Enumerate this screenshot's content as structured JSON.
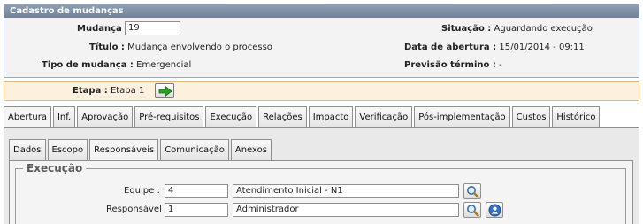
{
  "header": {
    "title": "Cadastro de mudanças",
    "mudanca_label": "Mudança :",
    "mudanca_value": "19",
    "titulo_label": "Título :",
    "titulo_value": "Mudança envolvendo o processo",
    "tipo_label": "Tipo de mudança :",
    "tipo_value": "Emergencial",
    "situacao_label": "Situação :",
    "situacao_value": "Aguardando execução",
    "abertura_label": "Data de abertura :",
    "abertura_value": "15/01/2014 - 09:11",
    "previsao_label": "Previsão término :",
    "previsao_value": "-"
  },
  "stage": {
    "label": "Etapa :",
    "value": "Etapa 1",
    "next_icon": "green-arrow-right-icon"
  },
  "outer_tabs": [
    {
      "label": "Abertura",
      "active": true
    },
    {
      "label": "Inf.",
      "active": false
    },
    {
      "label": "Aprovação",
      "active": false
    },
    {
      "label": "Pré-requisitos",
      "active": false
    },
    {
      "label": "Execução",
      "active": false
    },
    {
      "label": "Relações",
      "active": false
    },
    {
      "label": "Impacto",
      "active": false
    },
    {
      "label": "Verificação",
      "active": false
    },
    {
      "label": "Pós-implementação",
      "active": false
    },
    {
      "label": "Custos",
      "active": false
    },
    {
      "label": "Histórico",
      "active": false
    }
  ],
  "inner_tabs": [
    {
      "label": "Dados",
      "active": false
    },
    {
      "label": "Escopo",
      "active": false
    },
    {
      "label": "Responsáveis",
      "active": true
    },
    {
      "label": "Comunicação",
      "active": false
    },
    {
      "label": "Anexos",
      "active": false
    }
  ],
  "execucao": {
    "legend": "Execução",
    "equipe_label": "Equipe :",
    "equipe_code": "4",
    "equipe_name": "Atendimento Inicial - N1",
    "responsavel_label": "Responsável :",
    "responsavel_code": "1",
    "responsavel_name": "Administrador"
  },
  "colors": {
    "header_bar": "#7f91a6",
    "stage_bg": "#fdf0dc",
    "stage_border": "#e2b87c",
    "arrow_green": "#2e9e22",
    "info_blue": "#2f73c8"
  }
}
